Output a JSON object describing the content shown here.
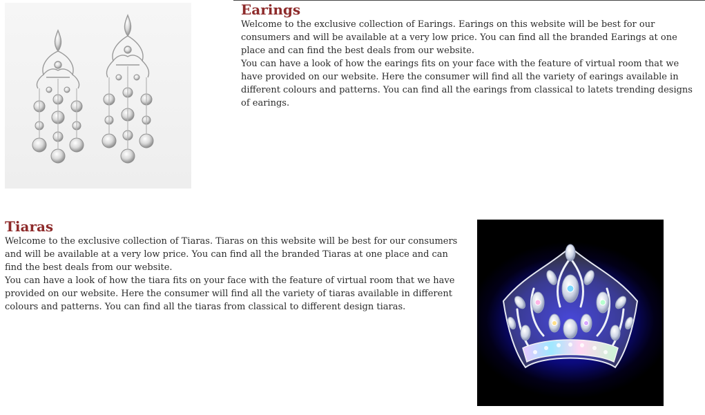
{
  "earings": {
    "title": "Earings",
    "paragraph1": "Welcome to the exclusive collection of Earings. Earings on this website will be best for our consumers and will be available at a very low price. You can find all the branded Earings at one place and can find the best deals from our website.",
    "paragraph2": "You can have a look of how the earings fits on your face with the feature of virtual room that we have provided on our website. Here the consumer will find all the variety of earings available in different colours and patterns. You can find all the earings from classical to latets trending designs of earings."
  },
  "tiaras": {
    "title": "Tiaras",
    "paragraph1": "Welcome to the exclusive collection of Tiaras. Tiaras on this website will be best for our consumers and will be available at a very low price. You can find all the branded Tiaras at one place and can find the best deals from our website.",
    "paragraph2": "You can have a look of how the tiara fits on your face with the feature of virtual room that we have provided on our website. Here the consumer will find all the variety of tiaras available in different colours and patterns. You can find all the tiaras from classical to different design tiaras."
  },
  "colors": {
    "heading": "#8e2b2b",
    "body_text": "#2a2a2a",
    "earing_backdrop": "#f2f2f2",
    "tiara_backdrop": "#0b0a7a"
  }
}
